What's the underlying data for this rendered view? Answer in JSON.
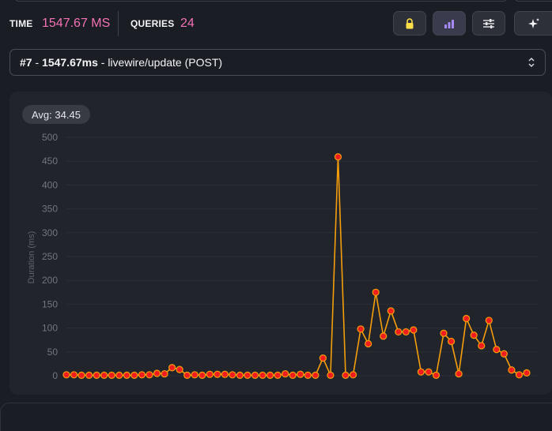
{
  "stats": {
    "time_label": "TIME",
    "time_value": "1547.67 MS",
    "queries_label": "QUERIES",
    "queries_value": "24"
  },
  "toolbar": {
    "buttons": [
      {
        "name": "lock-button",
        "icon": "lock-icon",
        "color": "#fde047"
      },
      {
        "name": "chart-button",
        "icon": "bar-chart-icon",
        "color": "#a78bfa"
      },
      {
        "name": "filters-button",
        "icon": "sliders-icon",
        "color": "#e5e7eb"
      },
      {
        "name": "sparkles-button",
        "icon": "sparkles-icon",
        "color": "#f3f4f6"
      }
    ]
  },
  "request_select": {
    "number": "#7",
    "sep1": " - ",
    "duration": "1547.67ms",
    "sep2": " - ",
    "route": "livewire/update (POST)"
  },
  "chart": {
    "avg_label": "Avg: 34.45"
  },
  "colors": {
    "accent_pink": "#f472b6",
    "line": "#f59e0b",
    "point_fill": "#ef1d1d",
    "point_stroke": "#f59e0b"
  },
  "chart_data": {
    "type": "line",
    "ylabel": "Duration (ms)",
    "xlabel": "",
    "ylim": [
      0,
      500
    ],
    "yticks": [
      "0",
      "50",
      "100",
      "150",
      "200",
      "250",
      "300",
      "350",
      "400",
      "450",
      "500"
    ],
    "grid": true,
    "series": [
      {
        "values": [
          2,
          2,
          1,
          1,
          1,
          1,
          1,
          1,
          1,
          1,
          2,
          2,
          5,
          4,
          17,
          13,
          1,
          2,
          1,
          3,
          3,
          3,
          2,
          1,
          1,
          1,
          1,
          1,
          1,
          4,
          1,
          3,
          1,
          1,
          37,
          1,
          459,
          1,
          2,
          98,
          67,
          175,
          83,
          136,
          92,
          92,
          96,
          8,
          8,
          1,
          89,
          72,
          4,
          120,
          85,
          63,
          116,
          55,
          46,
          12,
          2,
          6
        ]
      }
    ]
  }
}
